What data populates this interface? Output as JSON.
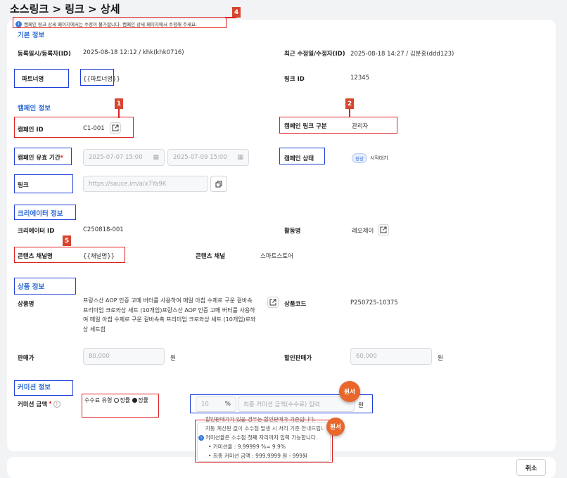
{
  "breadcrumb": {
    "root": "소스링크",
    "sep1": ">",
    "mid": "링크",
    "sep2": ">",
    "current": "상세"
  },
  "notice": "캠페인 링크 상세 페이지에서는 수정이 불가합니다. 캠페인 상세 페이지에서 수정해 주세요.",
  "basic": {
    "title": "기본 정보",
    "registered_label": "등록일시/등록자(ID)",
    "registered_value": "2025-08-18 12:12 / khk(khk0716)",
    "modified_label": "최근 수정일/수정자(ID)",
    "modified_value": "2025-08-18 14:27 / 김분홍(ddd123)",
    "partner_label": "파트너명",
    "partner_value": "{{파트너명}}",
    "link_id_label": "링크 ID",
    "link_id_value": "12345"
  },
  "campaign": {
    "title": "캠페인 정보",
    "id_label": "캠페인 ID",
    "id_value": "C1-001",
    "link_type_label": "캠페인 링크 구분",
    "link_type_value": "관리자",
    "period_label": "캠페인 유효 기간",
    "required_mark": "*",
    "start": "2025-07-07 15:00",
    "end": "2025-07-09 15:00",
    "status_label": "캠페인 상태",
    "status_badge": "정상",
    "status_text": "시작대기",
    "link_label": "링크",
    "link_value": "https://sauce.im/a/x7Ya9K"
  },
  "creator": {
    "title": "크리에이터 정보",
    "id_label": "크리에이터 ID",
    "id_value": "C250818-001",
    "activity_label": "활동명",
    "activity_value": "레오제이",
    "channel_name_label": "콘텐츠 채널명",
    "channel_name_value": "{{채널명}}",
    "channel_label": "콘텐츠 채널",
    "channel_value": "스마트스토어"
  },
  "product": {
    "title": "상품 정보",
    "name_label": "상품명",
    "name_lines": [
      "프랑스산 AOP 인증 고메 버터를 사용하여 매일 아침 수제로 구운 겉바속",
      "프리미엄 크로와상 세트 (10개입)프랑스산 AOP 인증 고메 버터를 사용하",
      "여 매일 아침 수제로 구운 겉바속촉 프리미엄 크로와상 세트 (10개입)로와",
      "상 세트힘"
    ],
    "code_label": "상품코드",
    "code_value": "P250725-10375",
    "price_label": "판매가",
    "price_value": "80,000",
    "price_unit": "원",
    "sale_label": "할인판매가",
    "sale_value": "60,000",
    "sale_unit": "원"
  },
  "commission": {
    "title": "커미션 정보",
    "amount_label": "커미션 금액",
    "required_mark": "*",
    "help_icon": "?",
    "type_label": "수수료 유형",
    "opt1": "정률",
    "opt2": "정률",
    "rate_value": "10",
    "percent": "%",
    "final_placeholder": "최종 커미션 금액(수수료) 입력",
    "unit": "원",
    "note1": "할인판매가가 있을 경우는 할인판매가 기준입니다.",
    "note2": "자동 계산된 값이 소수점 발생 시 처리 기준 안내드립니",
    "note3": "커미션율은 소수점 첫째 자리까지 입력 가능합니다.",
    "note4": "커미션율 : 9.99999 %= 9.9%",
    "note5": "최종 커미션 금액 : 999.9999 원 - 999원"
  },
  "annotations": {
    "n1": "1",
    "n2": "2",
    "n4": "4",
    "n5": "5",
    "badge": "원서"
  },
  "footer": {
    "cancel": "취소"
  }
}
